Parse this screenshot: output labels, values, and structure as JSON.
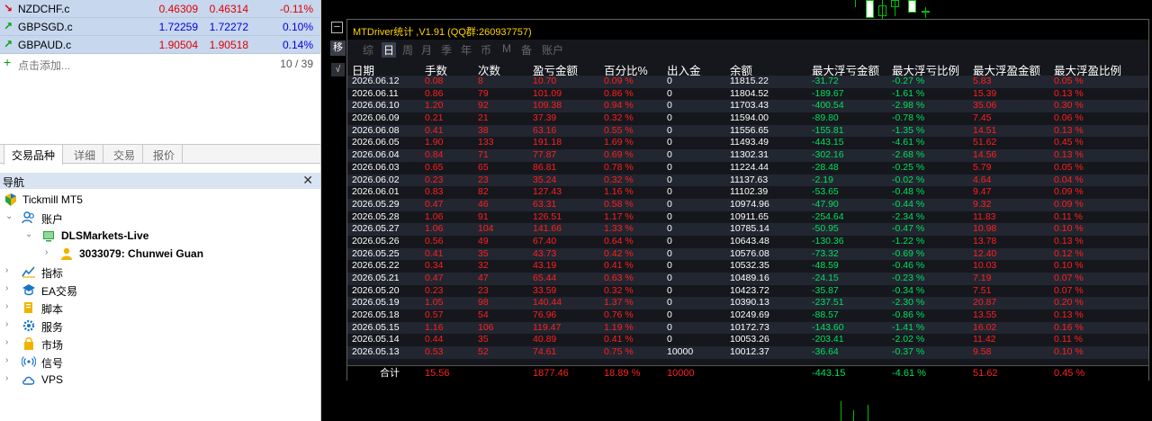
{
  "market_watch": {
    "rows": [
      {
        "symbol": "NZDCHF.c",
        "bid": "0.46309",
        "ask": "0.46314",
        "change": "-0.11%",
        "direction": "down",
        "color": "#e00000"
      },
      {
        "symbol": "GBPSGD.c",
        "bid": "1.72259",
        "ask": "1.72272",
        "change": "0.10%",
        "direction": "up",
        "color": "#0000e0"
      },
      {
        "symbol": "GBPAUD.c",
        "bid": "1.90504",
        "ask": "1.90518",
        "change": "0.14%",
        "direction": "up",
        "color": "#e00000"
      }
    ],
    "add_label": "点击添加...",
    "count": "10 / 39",
    "tabs": [
      "交易品种",
      "详细",
      "交易",
      "报价"
    ],
    "active_tab": "交易品种"
  },
  "navigator": {
    "title": "导航",
    "close": "✕",
    "broker": "Tickmill MT5",
    "accounts_label": "账户",
    "server": "DLSMarkets-Live",
    "account": "3033079: Chunwei Guan",
    "items": [
      {
        "label": "指标",
        "icon": "indicator-icon"
      },
      {
        "label": "EA交易",
        "icon": "expert-icon"
      },
      {
        "label": "脚本",
        "icon": "script-icon"
      },
      {
        "label": "服务",
        "icon": "service-icon"
      },
      {
        "label": "市场",
        "icon": "market-icon"
      },
      {
        "label": "信号",
        "icon": "signal-icon"
      },
      {
        "label": "VPS",
        "icon": "cloud-icon"
      }
    ]
  },
  "stats_panel": {
    "title": "MTDriver统计 ,V1.91 (QQ群:260937757)",
    "period_tabs": [
      "综",
      "日",
      "周",
      "月",
      "季",
      "年",
      "币",
      "M",
      "备",
      "账户"
    ],
    "active_period": "日",
    "side_button": "移",
    "check_button": "√",
    "columns": [
      "日期",
      "手数",
      "次数",
      "盈亏金额",
      "百分比%",
      "出入金",
      "余额",
      "最大浮亏金额",
      "最大浮亏比例",
      "最大浮盈金额",
      "最大浮盈比例"
    ],
    "rows": [
      [
        "2026.06.12",
        "0.08",
        "8",
        "10.70",
        "0.09 %",
        "0",
        "11815.22",
        "-31.72",
        "-0.27 %",
        "5.83",
        "0.05 %"
      ],
      [
        "2026.06.11",
        "0.86",
        "79",
        "101.09",
        "0.86 %",
        "0",
        "11804.52",
        "-189.67",
        "-1.61 %",
        "15.39",
        "0.13 %"
      ],
      [
        "2026.06.10",
        "1.20",
        "92",
        "109.38",
        "0.94 %",
        "0",
        "11703.43",
        "-400.54",
        "-2.98 %",
        "35.06",
        "0.30 %"
      ],
      [
        "2026.06.09",
        "0.21",
        "21",
        "37.39",
        "0.32 %",
        "0",
        "11594.00",
        "-89.80",
        "-0.78 %",
        "7.45",
        "0.06 %"
      ],
      [
        "2026.06.08",
        "0.41",
        "38",
        "63.16",
        "0.55 %",
        "0",
        "11556.65",
        "-155.81",
        "-1.35 %",
        "14.51",
        "0.13 %"
      ],
      [
        "2026.06.05",
        "1.90",
        "133",
        "191.18",
        "1.69 %",
        "0",
        "11493.49",
        "-443.15",
        "-4.61 %",
        "51.62",
        "0.45 %"
      ],
      [
        "2026.06.04",
        "0.84",
        "71",
        "77.87",
        "0.69 %",
        "0",
        "11302.31",
        "-302.16",
        "-2.68 %",
        "14.56",
        "0.13 %"
      ],
      [
        "2026.06.03",
        "0.65",
        "65",
        "86.81",
        "0.78 %",
        "0",
        "11224.44",
        "-28.48",
        "-0.25 %",
        "5.79",
        "0.05 %"
      ],
      [
        "2026.06.02",
        "0.23",
        "23",
        "35.24",
        "0.32 %",
        "0",
        "11137.63",
        "-2.19",
        "-0.02 %",
        "4.64",
        "0.04 %"
      ],
      [
        "2026.06.01",
        "0.83",
        "82",
        "127.43",
        "1.16 %",
        "0",
        "11102.39",
        "-53.65",
        "-0.48 %",
        "9.47",
        "0.09 %"
      ],
      [
        "2026.05.29",
        "0.47",
        "46",
        "63.31",
        "0.58 %",
        "0",
        "10974.96",
        "-47.90",
        "-0.44 %",
        "9.32",
        "0.09 %"
      ],
      [
        "2026.05.28",
        "1.06",
        "91",
        "126.51",
        "1.17 %",
        "0",
        "10911.65",
        "-254.64",
        "-2.34 %",
        "11.83",
        "0.11 %"
      ],
      [
        "2026.05.27",
        "1.06",
        "104",
        "141.66",
        "1.33 %",
        "0",
        "10785.14",
        "-50.95",
        "-0.47 %",
        "10.98",
        "0.10 %"
      ],
      [
        "2026.05.26",
        "0.56",
        "49",
        "67.40",
        "0.64 %",
        "0",
        "10643.48",
        "-130.36",
        "-1.22 %",
        "13.78",
        "0.13 %"
      ],
      [
        "2026.05.25",
        "0.41",
        "35",
        "43.73",
        "0.42 %",
        "0",
        "10576.08",
        "-73.32",
        "-0.69 %",
        "12.40",
        "0.12 %"
      ],
      [
        "2026.05.22",
        "0.34",
        "32",
        "43.19",
        "0.41 %",
        "0",
        "10532.35",
        "-48.59",
        "-0.46 %",
        "10.03",
        "0.10 %"
      ],
      [
        "2026.05.21",
        "0.47",
        "47",
        "65.44",
        "0.63 %",
        "0",
        "10489.16",
        "-24.15",
        "-0.23 %",
        "7.19",
        "0.07 %"
      ],
      [
        "2026.05.20",
        "0.23",
        "23",
        "33.59",
        "0.32 %",
        "0",
        "10423.72",
        "-35.87",
        "-0.34 %",
        "7.51",
        "0.07 %"
      ],
      [
        "2026.05.19",
        "1.05",
        "98",
        "140.44",
        "1.37 %",
        "0",
        "10390.13",
        "-237.51",
        "-2.30 %",
        "20.87",
        "0.20 %"
      ],
      [
        "2026.05.18",
        "0.57",
        "54",
        "76.96",
        "0.76 %",
        "0",
        "10249.69",
        "-88.57",
        "-0.86 %",
        "13.55",
        "0.13 %"
      ],
      [
        "2026.05.15",
        "1.16",
        "106",
        "119.47",
        "1.19 %",
        "0",
        "10172.73",
        "-143.60",
        "-1.41 %",
        "16.02",
        "0.16 %"
      ],
      [
        "2026.05.14",
        "0.44",
        "35",
        "40.89",
        "0.41 %",
        "0",
        "10053.26",
        "-203.41",
        "-2.02 %",
        "11.42",
        "0.11 %"
      ],
      [
        "2026.05.13",
        "0.53",
        "52",
        "74.61",
        "0.75 %",
        "10000",
        "10012.37",
        "-36.64",
        "-0.37 %",
        "9.58",
        "0.10 %"
      ]
    ],
    "totals": {
      "label": "合计",
      "lots": "15.56",
      "pnl": "1877.46",
      "pct": "18.89 %",
      "deposit": "10000",
      "max_loss": "-443.15",
      "max_loss_pct": "-4.61 %",
      "max_profit": "51.62",
      "max_profit_pct": "0.45 %"
    }
  },
  "colors": {
    "profit": "#ff2020",
    "loss": "#00e060",
    "title": "#ffd400",
    "panel_bg": "#15171c"
  }
}
